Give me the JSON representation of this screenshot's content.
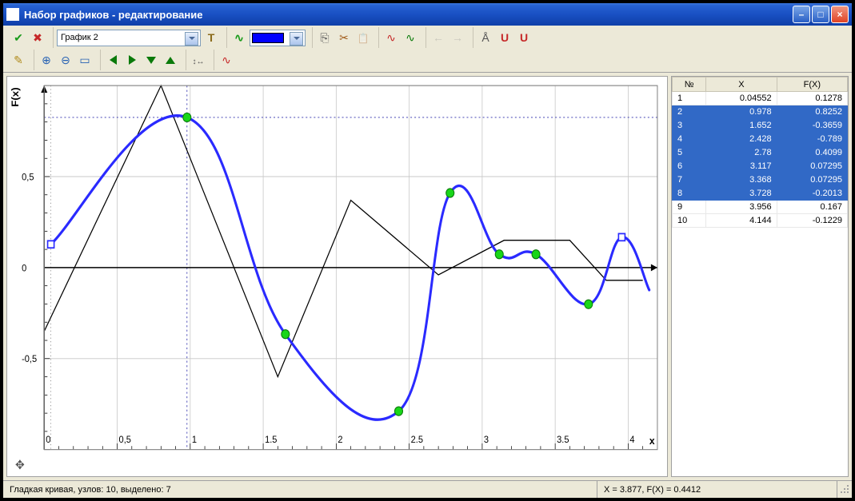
{
  "window": {
    "title": "Набор графиков - редактирование"
  },
  "toolbar1": {
    "graph_selector": "График 2",
    "color": "#0000ff"
  },
  "status": {
    "left": "Гладкая кривая, узлов: 10, выделено: 7",
    "right": "X = 3.877, F(X) = 0.4412"
  },
  "table": {
    "headers": {
      "n": "№",
      "x": "X",
      "fx": "F(X)"
    },
    "rows": [
      {
        "n": "1",
        "x": "0.04552",
        "fx": "0.1278",
        "sel": false
      },
      {
        "n": "2",
        "x": "0.978",
        "fx": "0.8252",
        "sel": true
      },
      {
        "n": "3",
        "x": "1.652",
        "fx": "-0.3659",
        "sel": true
      },
      {
        "n": "4",
        "x": "2.428",
        "fx": "-0.789",
        "sel": true
      },
      {
        "n": "5",
        "x": "2.78",
        "fx": "0.4099",
        "sel": true
      },
      {
        "n": "6",
        "x": "3.117",
        "fx": "0.07295",
        "sel": true
      },
      {
        "n": "7",
        "x": "3.368",
        "fx": "0.07295",
        "sel": true
      },
      {
        "n": "8",
        "x": "3.728",
        "fx": "-0.2013",
        "sel": true
      },
      {
        "n": "9",
        "x": "3.956",
        "fx": "0.167",
        "sel": false
      },
      {
        "n": "10",
        "x": "4.144",
        "fx": "-0.1229",
        "sel": false
      }
    ]
  },
  "chart_data": {
    "type": "line",
    "xlabel": "x",
    "ylabel": "F(x)",
    "xlim": [
      0,
      4.2
    ],
    "ylim": [
      -1.0,
      1.0
    ],
    "xticks": [
      0,
      0.5,
      1,
      1.5,
      2,
      2.5,
      3,
      3.5,
      4
    ],
    "yticks": [
      -0.5,
      0,
      0.5
    ],
    "series": [
      {
        "name": "smooth-curve",
        "color": "#2a2aff",
        "style": "smooth",
        "points": [
          [
            0.04552,
            0.1278
          ],
          [
            0.978,
            0.8252
          ],
          [
            1.652,
            -0.3659
          ],
          [
            2.428,
            -0.789
          ],
          [
            2.78,
            0.4099
          ],
          [
            3.117,
            0.07295
          ],
          [
            3.368,
            0.07295
          ],
          [
            3.728,
            -0.2013
          ],
          [
            3.956,
            0.167
          ],
          [
            4.144,
            -0.1229
          ]
        ],
        "markers_selected": [
          1,
          2,
          3,
          4,
          5,
          6,
          7
        ],
        "anchor_open": [
          0,
          8
        ]
      },
      {
        "name": "polyline",
        "color": "#000000",
        "style": "linear",
        "points": [
          [
            0.0,
            -0.35
          ],
          [
            0.8,
            1.0
          ],
          [
            1.6,
            -0.6
          ],
          [
            2.1,
            0.37
          ],
          [
            2.7,
            -0.04
          ],
          [
            3.15,
            0.15
          ],
          [
            3.6,
            0.15
          ],
          [
            3.85,
            -0.07
          ],
          [
            4.1,
            -0.07
          ]
        ]
      }
    ],
    "crosshair": {
      "x": 0.978,
      "y": 0.8252
    }
  }
}
